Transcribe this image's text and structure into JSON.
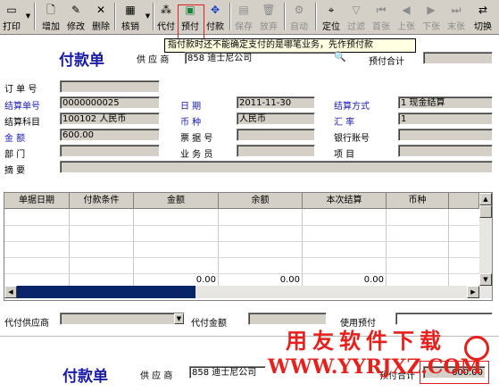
{
  "toolbar": {
    "print": "打印",
    "add": "增加",
    "modify": "修改",
    "delete": "删除",
    "writeoff": "核销",
    "agent_pay": "代付",
    "prepay": "预付",
    "pay": "付款",
    "save": "保存",
    "discard": "放弃",
    "auto": "自动",
    "locate": "定位",
    "filter": "过滤",
    "first": "首张",
    "prev": "上张",
    "next": "下张",
    "last": "末张",
    "switch": "切换"
  },
  "tooltip": "指付款时还不能确定支付的是哪笔业务，先作预付款",
  "form": {
    "title": "付款单",
    "supplier_label": "供 应 商",
    "supplier_value": "858  迪士尼公司",
    "prepay_total_label": "预付合计",
    "order_no_label": "订 单 号",
    "voucher_no_label": "结算单号",
    "voucher_no_value": "0000000025",
    "date_label": "日    期",
    "date_value": "2011-11-30",
    "settle_method_label": "结算方式",
    "settle_method_value": "1  现金结算",
    "account_label": "结算科目",
    "account_value": "100102  人民币",
    "currency_label": "币    种",
    "currency_value": "人民币",
    "rate_label": "汇    率",
    "rate_value": "1",
    "amount_label": "金    额",
    "amount_value": "600.00",
    "bill_no_label": "票 据 号",
    "bank_account_label": "银行账号",
    "dept_label": "部    门",
    "salesman_label": "业 务 员",
    "project_label": "项    目",
    "memo_label": "摘    要"
  },
  "grid": {
    "columns": [
      "单据日期",
      "付款条件",
      "金额",
      "余额",
      "本次结算",
      "币种"
    ],
    "totals": [
      "0.00",
      "0.00",
      "0.00"
    ]
  },
  "bottom": {
    "agent_supplier_label": "代付供应商",
    "agent_amount_label": "代付金额",
    "use_prepay_label": "使用预付"
  },
  "watermark": {
    "text": "用友软件下载",
    "url": "WWW.YYRJXZ.COM"
  },
  "second": {
    "title": "付款单",
    "supplier_label": "供 应 商",
    "supplier_value": "858  迪士尼公司",
    "prepay_total_label": "预付合计",
    "prepay_total_value": "600.00"
  }
}
